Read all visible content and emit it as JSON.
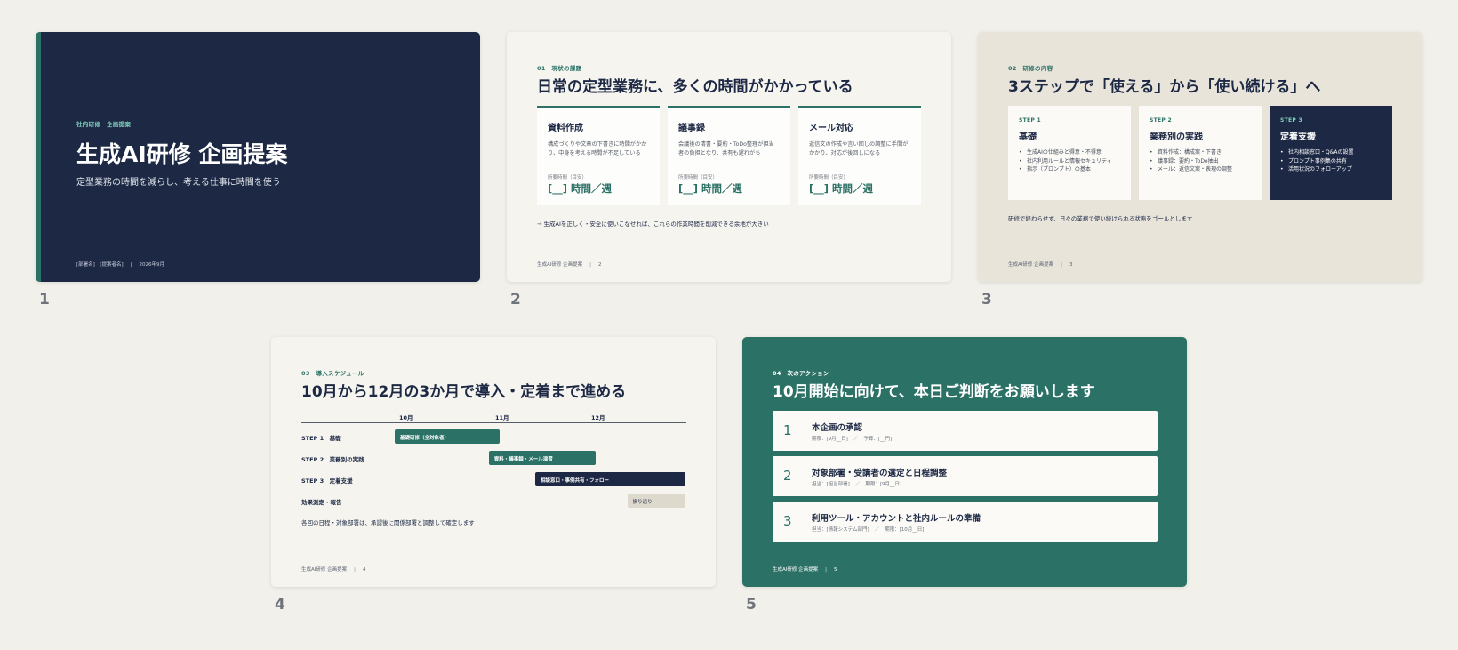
{
  "slides": [
    {
      "number": "1",
      "eyebrow": "社内研修　企画提案",
      "title": "生成AI研修 企画提案",
      "subtitle": "定型業務の時間を減らし、考える仕事に時間を使う",
      "footer_left": "[部署名]　[提案者名]",
      "footer_sep": "|",
      "footer_right": "2026年9月"
    },
    {
      "number": "2",
      "eyebrow": "01　現状の課題",
      "title": "日常の定型業務に、多くの時間がかかっている",
      "cards": [
        {
          "title": "資料作成",
          "desc": "構成づくりや文章の下書きに時間がかかり、中身を考える時間が不足している",
          "label": "所要時間（目安）",
          "value": "[__] 時間／週"
        },
        {
          "title": "議事録",
          "desc": "会議後の清書・要約・ToDo整理が担当者の負担となり、共有も遅れがち",
          "label": "所要時間（目安）",
          "value": "[__] 時間／週"
        },
        {
          "title": "メール対応",
          "desc": "返信文の作成や言い回しの調整に手間がかかり、対応が後回しになる",
          "label": "所要時間（目安）",
          "value": "[__] 時間／週"
        }
      ],
      "note": "→ 生成AIを正しく・安全に使いこなせれば、これらの作業時間を削減できる余地が大きい",
      "footer_left": "生成AI研修 企画提案",
      "footer_sep": "|",
      "footer_right": "2"
    },
    {
      "number": "3",
      "eyebrow": "02　研修の内容",
      "title": "3ステップで「使える」から「使い続ける」へ",
      "steps": [
        {
          "step": "STEP 1",
          "title": "基礎",
          "items": [
            "生成AIの仕組みと得意・不得意",
            "社内利用ルールと情報セキュリティ",
            "指示（プロンプト）の基本"
          ]
        },
        {
          "step": "STEP 2",
          "title": "業務別の実践",
          "items": [
            "資料作成：構成案・下書き",
            "議事録：要約・ToDo抽出",
            "メール：返信文案・表現の調整"
          ]
        },
        {
          "step": "STEP 3",
          "title": "定着支援",
          "items": [
            "社内相談窓口・Q&Aの設置",
            "プロンプト事例集の共有",
            "活用状況のフォローアップ"
          ]
        }
      ],
      "note": "研修で終わらせず、日々の業務で使い続けられる状態をゴールとします",
      "footer_left": "生成AI研修 企画提案",
      "footer_sep": "|",
      "footer_right": "3"
    },
    {
      "number": "4",
      "eyebrow": "03　導入スケジュール",
      "title": "10月から12月の3か月で導入・定着まで進める",
      "months": [
        "10月",
        "11月",
        "12月"
      ],
      "rows": [
        {
          "label": "STEP 1　基礎",
          "bar": "基礎研修（全対象者）",
          "start_month": 0.0,
          "end_month": 1.08,
          "color": "#2c7166"
        },
        {
          "label": "STEP 2　業務別の実践",
          "bar": "資料・議事録・メール演習",
          "start_month": 0.97,
          "end_month": 2.07,
          "color": "#2c7166"
        },
        {
          "label": "STEP 3　定着支援",
          "bar": "相談窓口・事例共有・フォロー",
          "start_month": 1.45,
          "end_month": 3.0,
          "color": "#1c2844"
        },
        {
          "label": "効果測定・報告",
          "bar": "振り返り",
          "start_month": 2.4,
          "end_month": 3.0,
          "color": "#ddd9cc"
        }
      ],
      "note": "各回の日程・対象部署は、承認後に関係部署と調整して確定します",
      "footer_left": "生成AI研修 企画提案",
      "footer_sep": "|",
      "footer_right": "4"
    },
    {
      "number": "5",
      "eyebrow": "04　次のアクション",
      "title": "10月開始に向けて、本日ご判断をお願いします",
      "actions": [
        {
          "num": "1",
          "title": "本企画の承認",
          "meta_left": "期限：[9月__日]",
          "meta_sep": "／",
          "meta_right": "予算：[__円]"
        },
        {
          "num": "2",
          "title": "対象部署・受講者の選定と日程調整",
          "meta_left": "担当：[担当部署]",
          "meta_sep": "／",
          "meta_right": "期限：[9月__日]"
        },
        {
          "num": "3",
          "title": "利用ツール・アカウントと社内ルールの準備",
          "meta_left": "担当：[情報システム部門]",
          "meta_sep": "／",
          "meta_right": "期限：[10月__日]"
        }
      ],
      "footer_left": "生成AI研修 企画提案",
      "footer_sep": "|",
      "footer_right": "5"
    }
  ],
  "colors": {
    "navy": "#1c2844",
    "teal": "#2c7166",
    "cream": "#f5f4ef",
    "beige": "#e8e4da",
    "background": "#f1f0eb"
  }
}
